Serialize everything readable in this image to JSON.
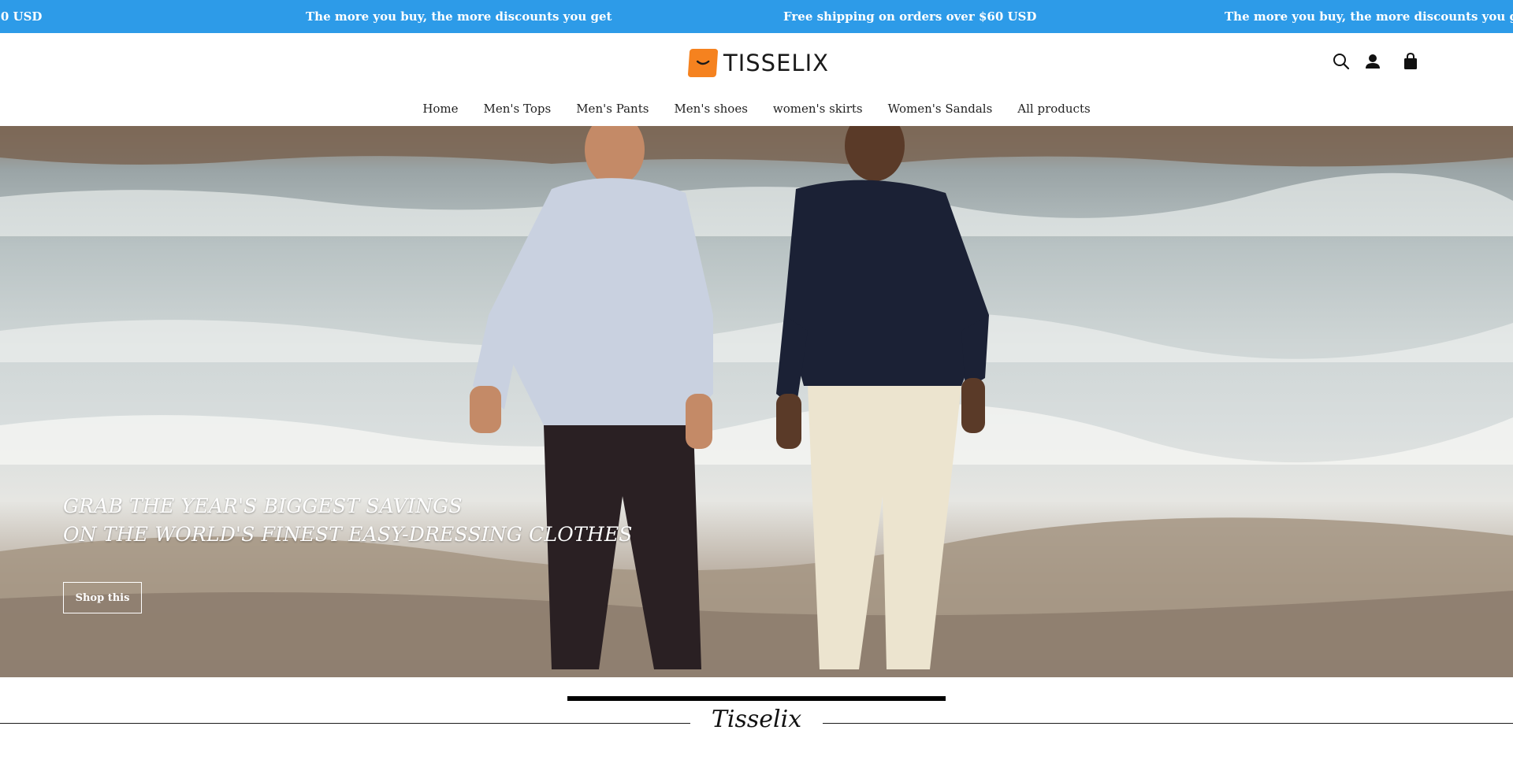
{
  "announcement": {
    "items": [
      "Free shipping on orders over $60 USD",
      "The more you buy, the more discounts you get",
      "Free shipping on orders over $60 USD",
      "The more you buy, the more discounts you get"
    ],
    "background": "#2d9be8"
  },
  "header": {
    "logo_text": "TISSELIX",
    "logo_color": "#f5821f",
    "icons": [
      "search-icon",
      "account-icon",
      "cart-icon"
    ]
  },
  "nav": {
    "items": [
      {
        "label": "Home"
      },
      {
        "label": "Men's Tops"
      },
      {
        "label": "Men's Pants"
      },
      {
        "label": "Men's shoes"
      },
      {
        "label": "women's skirts"
      },
      {
        "label": "Women's Sandals"
      },
      {
        "label": "All products"
      }
    ]
  },
  "hero": {
    "headline_line1": "GRAB THE YEAR'S BIGGEST SAVINGS",
    "headline_line2": "ON THE WORLD'S FINEST EASY-DRESSING CLOTHES",
    "button_label": "Shop this"
  },
  "brand_section": {
    "title": "Tisselix"
  }
}
